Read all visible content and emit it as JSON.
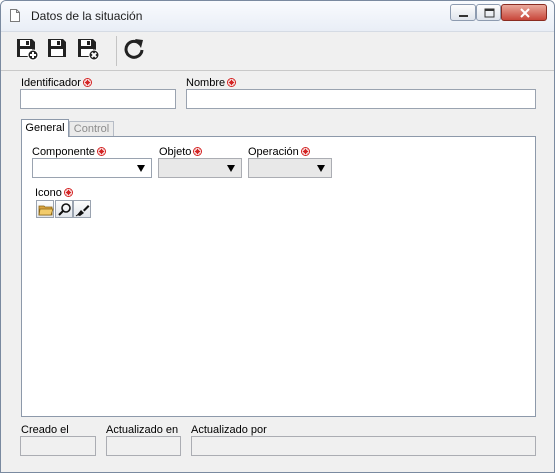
{
  "window": {
    "title": "Datos de la situación"
  },
  "form": {
    "identificador_label": "Identificador",
    "nombre_label": "Nombre"
  },
  "tabs": [
    {
      "label": "General",
      "active": true
    },
    {
      "label": "Control",
      "active": false
    }
  ],
  "general": {
    "componente_label": "Componente",
    "objeto_label": "Objeto",
    "operacion_label": "Operación",
    "icono_label": "Icono"
  },
  "footer": {
    "creado_label": "Creado el",
    "actualizado_en_label": "Actualizado en",
    "actualizado_por_label": "Actualizado por"
  },
  "icons": {
    "save_new": "save-new-icon",
    "save": "save-icon",
    "save_close": "save-close-icon",
    "refresh": "refresh-icon",
    "required": "required-asterisk-icon",
    "folder": "folder-open-icon",
    "search": "magnifier-icon",
    "clear": "eraser-icon"
  },
  "colors": {
    "required": "#d32222",
    "tab_border": "#8d99aa"
  }
}
